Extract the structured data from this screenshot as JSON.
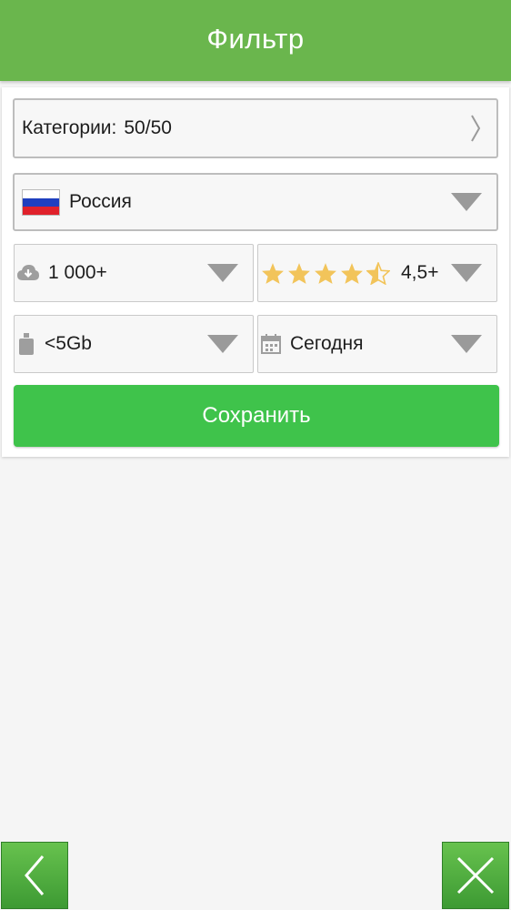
{
  "header": {
    "title": "Фильтр"
  },
  "filters": {
    "categories_label": "Категории:",
    "categories_value": "50/50",
    "country": "Россия",
    "downloads": "1 000+",
    "rating": "4,5+",
    "size": "<5Gb",
    "date": "Сегодня"
  },
  "save_label": "Сохранить",
  "colors": {
    "header": "#6ab64d",
    "save_button": "#3fc34b",
    "star": "#f2c45a",
    "nav_button": "#4caf3f"
  },
  "icons": {
    "country": "russia-flag-icon",
    "downloads": "cloud-download-icon",
    "size": "weight-icon",
    "date": "calendar-icon",
    "back": "chevron-left-icon",
    "close": "close-icon"
  }
}
